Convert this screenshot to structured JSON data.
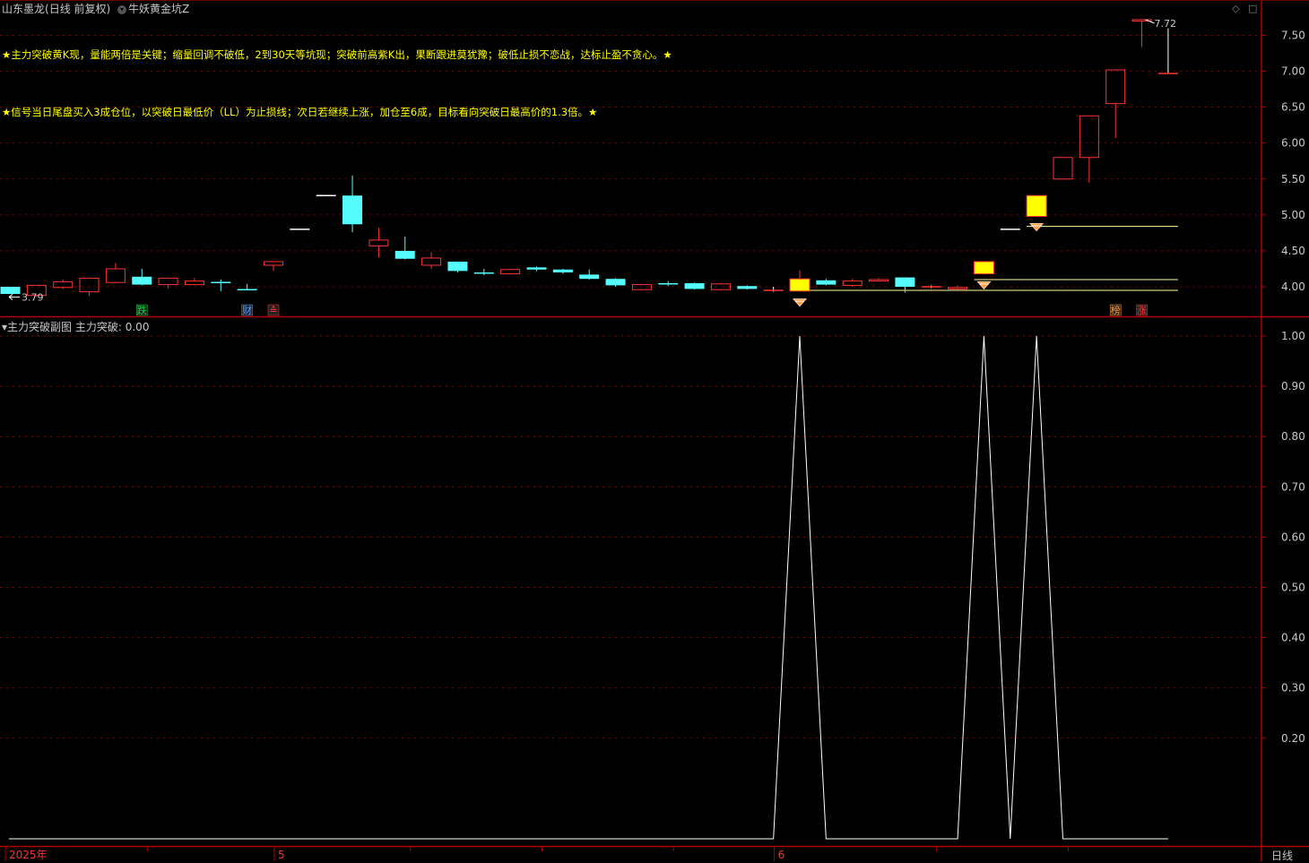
{
  "header": {
    "stock_name": "山东墨龙",
    "mode": "(日线 前复权)",
    "indicator_name": "牛妖黄金坑Z"
  },
  "notes": {
    "line1": "★主力突破黄K现，量能两倍是关键；缩量回调不破低，2到30天等坑现；突破前高紫K出，果断跟进莫犹豫；破低止损不恋战，达标止盈不贪心。★",
    "line2": "★信号当日尾盘买入3成仓位，以突破日最低价（LL）为止损线；次日若继续上涨，加仓至6成，目标看向突破日最高价的1.3倍。★"
  },
  "subchart": {
    "title": "主力突破副图",
    "value_label": "主力突破: 0.00"
  },
  "timeframe_label": "日线",
  "icons": {
    "top_right_1": "diamond-icon",
    "top_right_2": "square-icon"
  },
  "colors": {
    "up": "#ff3333",
    "down": "#54fcfc",
    "signal": "#ffff00",
    "grid": "#8b0000",
    "axis_text": "#c8c8c8",
    "line": "#ffffff"
  },
  "chart_data": [
    {
      "type": "candlestick",
      "y_ticks": [
        "7.50",
        "7.00",
        "6.50",
        "6.00",
        "5.50",
        "5.00",
        "4.50",
        "4.00"
      ],
      "ylim": [
        3.6,
        7.9
      ],
      "annotations": {
        "low_label": "3.79",
        "high_label": "7.72"
      },
      "candles": [
        {
          "o": 4.0,
          "c": 3.9,
          "h": 4.0,
          "l": 3.9
        },
        {
          "o": 3.88,
          "c": 4.02,
          "h": 4.02,
          "l": 3.86
        },
        {
          "o": 3.99,
          "c": 4.07,
          "h": 4.1,
          "l": 3.97
        },
        {
          "o": 3.93,
          "c": 4.12,
          "h": 4.12,
          "l": 3.87
        },
        {
          "o": 4.06,
          "c": 4.25,
          "h": 4.33,
          "l": 4.05
        },
        {
          "o": 4.14,
          "c": 4.03,
          "h": 4.25,
          "l": 4.02
        },
        {
          "o": 4.03,
          "c": 4.12,
          "h": 4.12,
          "l": 3.98
        },
        {
          "o": 4.03,
          "c": 4.08,
          "h": 4.12,
          "l": 4.02
        },
        {
          "o": 4.07,
          "c": 4.06,
          "h": 4.1,
          "l": 3.94
        },
        {
          "o": 3.97,
          "c": 3.96,
          "h": 4.04,
          "l": 3.95
        },
        {
          "o": 4.3,
          "c": 4.35,
          "h": 4.35,
          "l": 4.22
        },
        {
          "o": 4.8,
          "c": 4.8,
          "h": 4.8,
          "l": 4.8
        },
        {
          "o": 5.27,
          "c": 5.27,
          "h": 5.27,
          "l": 5.27
        },
        {
          "o": 5.27,
          "c": 4.87,
          "h": 5.55,
          "l": 4.76
        },
        {
          "o": 4.57,
          "c": 4.65,
          "h": 4.82,
          "l": 4.41
        },
        {
          "o": 4.5,
          "c": 4.39,
          "h": 4.7,
          "l": 4.38
        },
        {
          "o": 4.3,
          "c": 4.4,
          "h": 4.48,
          "l": 4.25
        },
        {
          "o": 4.35,
          "c": 4.22,
          "h": 4.35,
          "l": 4.2
        },
        {
          "o": 4.2,
          "c": 4.19,
          "h": 4.25,
          "l": 4.16
        },
        {
          "o": 4.18,
          "c": 4.24,
          "h": 4.25,
          "l": 4.17
        },
        {
          "o": 4.27,
          "c": 4.24,
          "h": 4.28,
          "l": 4.22
        },
        {
          "o": 4.24,
          "c": 4.2,
          "h": 4.25,
          "l": 4.18
        },
        {
          "o": 4.17,
          "c": 4.11,
          "h": 4.24,
          "l": 4.1
        },
        {
          "o": 4.11,
          "c": 4.02,
          "h": 4.12,
          "l": 4.0
        },
        {
          "o": 3.96,
          "c": 4.03,
          "h": 4.04,
          "l": 3.95
        },
        {
          "o": 4.05,
          "c": 4.04,
          "h": 4.08,
          "l": 4.01
        },
        {
          "o": 4.05,
          "c": 3.97,
          "h": 4.06,
          "l": 3.96
        },
        {
          "o": 3.96,
          "c": 4.04,
          "h": 4.05,
          "l": 3.95
        },
        {
          "o": 4.01,
          "c": 3.97,
          "h": 4.02,
          "l": 3.96
        },
        {
          "o": 3.94,
          "c": 3.95,
          "h": 4.0,
          "l": 3.93
        },
        {
          "o": 3.94,
          "c": 4.11,
          "h": 4.23,
          "l": 3.93,
          "signal": true
        },
        {
          "o": 4.09,
          "c": 4.03,
          "h": 4.11,
          "l": 4.02
        },
        {
          "o": 4.02,
          "c": 4.08,
          "h": 4.11,
          "l": 4.0
        },
        {
          "o": 4.08,
          "c": 4.1,
          "h": 4.12,
          "l": 4.07
        },
        {
          "o": 4.13,
          "c": 4.0,
          "h": 4.13,
          "l": 3.92
        },
        {
          "o": 3.99,
          "c": 4.0,
          "h": 4.02,
          "l": 3.98
        },
        {
          "o": 3.97,
          "c": 3.99,
          "h": 4.02,
          "l": 3.96
        },
        {
          "o": 4.18,
          "c": 4.35,
          "h": 4.35,
          "l": 4.17,
          "signal": true
        },
        {
          "o": 4.8,
          "c": 4.8,
          "h": 4.8,
          "l": 4.8
        },
        {
          "o": 4.98,
          "c": 5.27,
          "h": 5.27,
          "l": 4.98,
          "signal": true
        },
        {
          "o": 5.5,
          "c": 5.8,
          "h": 5.8,
          "l": 5.5
        },
        {
          "o": 5.8,
          "c": 6.38,
          "h": 6.38,
          "l": 5.45
        },
        {
          "o": 6.55,
          "c": 7.02,
          "h": 7.02,
          "l": 6.07
        },
        {
          "o": 7.7,
          "c": 7.72,
          "h": 7.72,
          "l": 7.34
        },
        {
          "o": 6.97,
          "c": 6.97,
          "h": 7.6,
          "l": 6.97
        }
      ],
      "support_lines": [
        {
          "from": 30,
          "to": 44,
          "value": 3.95
        },
        {
          "from": 37,
          "to": 44,
          "value": 4.1
        },
        {
          "from": 39,
          "to": 44,
          "value": 4.84
        }
      ],
      "badges": [
        {
          "index": 5,
          "text": "跌",
          "color": "#22cc44"
        },
        {
          "index": 9,
          "text": "财",
          "color": "#5599ff"
        },
        {
          "index": 10,
          "text": "≙",
          "color": "#ff3333"
        },
        {
          "index": 42,
          "text": "榜",
          "color": "#ff9933"
        },
        {
          "index": 43,
          "text": "涨",
          "color": "#ff3333"
        }
      ],
      "markers": [
        30,
        37,
        39
      ]
    },
    {
      "type": "line",
      "y_ticks": [
        "1.00",
        "0.90",
        "0.80",
        "0.70",
        "0.60",
        "0.50",
        "0.40",
        "0.30",
        "0.20"
      ],
      "ylim": [
        0,
        1
      ],
      "values": [
        0,
        0,
        0,
        0,
        0,
        0,
        0,
        0,
        0,
        0,
        0,
        0,
        0,
        0,
        0,
        0,
        0,
        0,
        0,
        0,
        0,
        0,
        0,
        0,
        0,
        0,
        0,
        0,
        0,
        0,
        1,
        0,
        0,
        0,
        0,
        0,
        0,
        1,
        0,
        1,
        0,
        0,
        0,
        0,
        0
      ]
    }
  ],
  "x_axis": {
    "labels": [
      {
        "index": 0,
        "text": "2025年"
      },
      {
        "index": 10,
        "text": "5"
      },
      {
        "index": 29,
        "text": "6"
      }
    ]
  }
}
